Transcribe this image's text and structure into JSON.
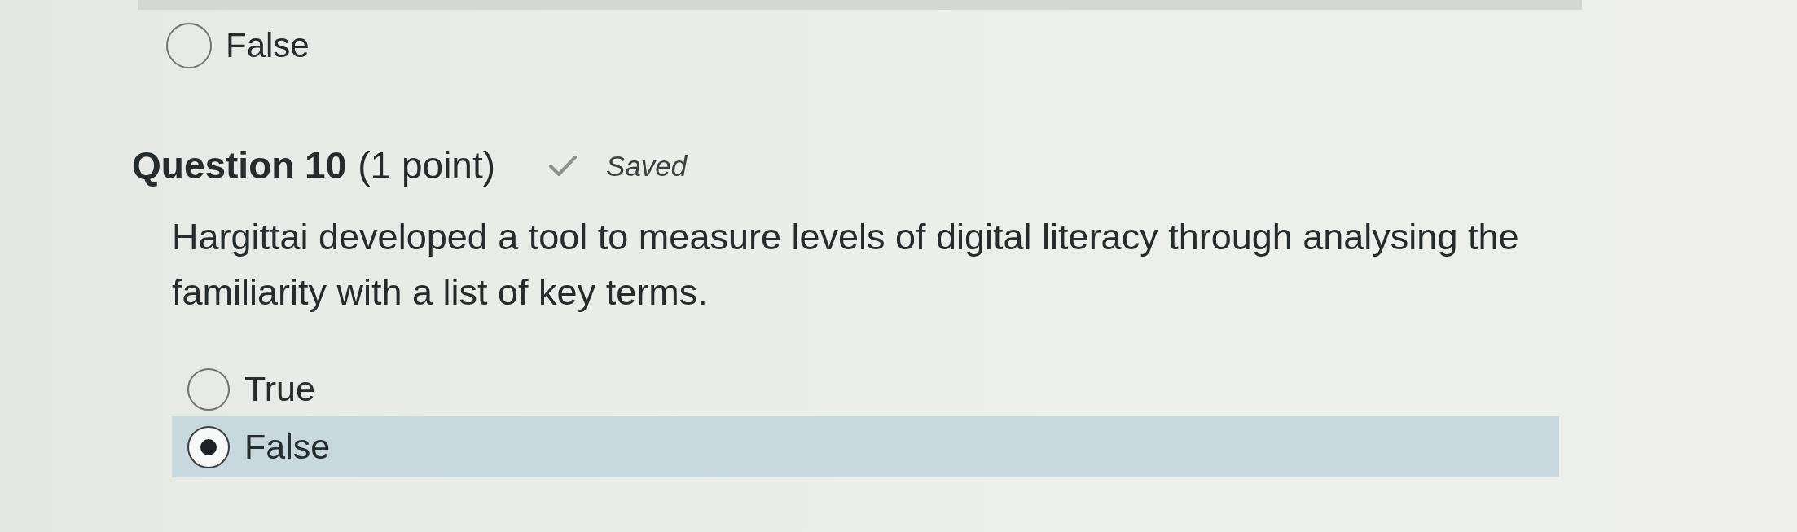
{
  "previous_question": {
    "options": [
      {
        "label": "False",
        "selected": false
      }
    ]
  },
  "question": {
    "title": "Question 10",
    "points": "(1 point)",
    "status": {
      "kind": "saved",
      "label": "Saved"
    },
    "text": "Hargittai developed a tool to measure levels of digital literacy through analysing the familiarity with a list of key terms.",
    "options": [
      {
        "label": "True",
        "selected": false
      },
      {
        "label": "False",
        "selected": true
      }
    ]
  }
}
